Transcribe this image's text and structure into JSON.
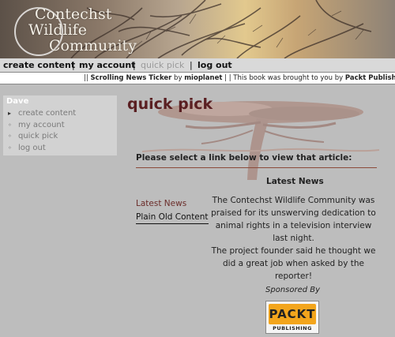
{
  "header": {
    "logo_line1": "Contechst",
    "logo_line2": "Wildlife",
    "logo_line3": "Community"
  },
  "primary_nav": {
    "items": [
      {
        "label": "create content",
        "active": false
      },
      {
        "label": "my account",
        "active": false
      },
      {
        "label": "quick pick",
        "active": true
      },
      {
        "label": "log out",
        "active": false
      }
    ],
    "separator": "|"
  },
  "ticker": {
    "prefix": "|| ",
    "module_name": "Scrolling News Ticker",
    "by": " by ",
    "author": "mioplanet",
    "middle": " | | This book was brought to you by ",
    "publisher": "Packt Publishing",
    "suffix": " | | ("
  },
  "sidebar": {
    "title": "Dave",
    "items": [
      {
        "label": "create content",
        "bullet": "▸"
      },
      {
        "label": "my account",
        "bullet": "◦"
      },
      {
        "label": "quick pick",
        "bullet": "◦"
      },
      {
        "label": "log out",
        "bullet": "◦"
      }
    ]
  },
  "main": {
    "title": "quick pick",
    "instruction": "Please select a link below to view that article:",
    "links": [
      {
        "label": "Latest News"
      },
      {
        "label": "Plain Old Content"
      }
    ],
    "article": {
      "title": "Latest News",
      "paragraph1": "The Contechst Wildlife Community was praised for its unswerving dedication to animal rights in a television interview last night.",
      "paragraph2": "The project founder said he thought we did a great job when asked by the reporter!"
    },
    "sponsor": {
      "label": "Sponsored By",
      "logo_top": "PACKT",
      "logo_bottom": "PUBLISHING"
    }
  },
  "colors": {
    "title": "#5a1f22",
    "link_active": "#6b2d2a",
    "accent_orange": "#f3a51c"
  }
}
